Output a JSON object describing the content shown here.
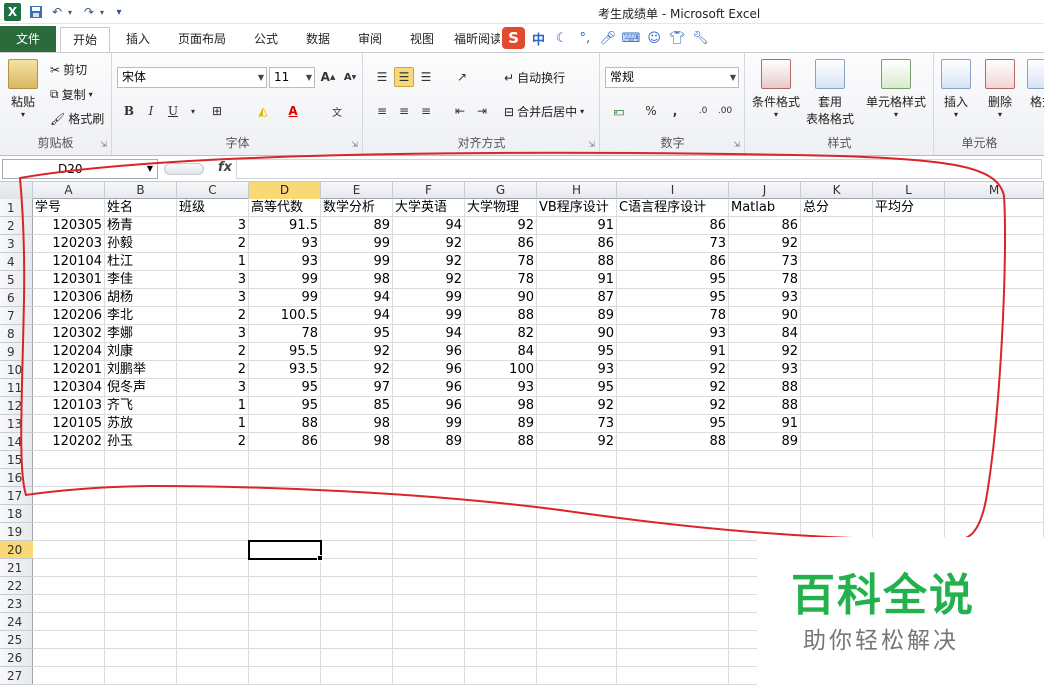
{
  "window": {
    "title": "考生成绩单 - Microsoft Excel",
    "app_icon": "X"
  },
  "quick_access": {
    "save": "save-icon",
    "undo": "undo-icon",
    "redo": "redo-icon",
    "customize": "customize-icon"
  },
  "tabs": [
    "文件",
    "开始",
    "插入",
    "页面布局",
    "公式",
    "数据",
    "审阅",
    "视图",
    "福昕阅读"
  ],
  "ime": {
    "logo": "S",
    "mode": "中"
  },
  "ribbon": {
    "clipboard": {
      "label": "剪贴板",
      "paste": "粘贴",
      "cut": "剪切",
      "copy": "复制",
      "format_painter": "格式刷"
    },
    "font": {
      "label": "字体",
      "family": "宋体",
      "size": "11"
    },
    "alignment": {
      "label": "对齐方式",
      "wrap": "自动换行",
      "merge": "合并后居中"
    },
    "number": {
      "label": "数字",
      "format": "常规"
    },
    "styles": {
      "label": "样式",
      "conditional": "条件格式",
      "table_line1": "套用",
      "table_line2": "表格格式",
      "cell_styles": "单元格样式"
    },
    "cells": {
      "label": "单元格",
      "insert": "插入",
      "delete": "删除",
      "format": "格式"
    }
  },
  "formula_bar": {
    "name_box": "D20",
    "fx": "fx",
    "content": ""
  },
  "columns": [
    "A",
    "B",
    "C",
    "D",
    "E",
    "F",
    "G",
    "H",
    "I",
    "J",
    "K",
    "L",
    "M"
  ],
  "rows": [
    "1",
    "2",
    "3",
    "4",
    "5",
    "6",
    "7",
    "8",
    "9",
    "10",
    "11",
    "12",
    "13",
    "14",
    "15",
    "16",
    "17",
    "18",
    "19",
    "20",
    "21",
    "22",
    "23",
    "24",
    "25",
    "26",
    "27"
  ],
  "selected": {
    "column": "D",
    "row": "20"
  },
  "sheet": {
    "headers": [
      "学号",
      "姓名",
      "班级",
      "高等代数",
      "数学分析",
      "大学英语",
      "大学物理",
      "VB程序设计",
      "C语言程序设计",
      "Matlab",
      "总分",
      "平均分"
    ],
    "rows": [
      [
        "120305",
        "杨青",
        "3",
        "91.5",
        "89",
        "94",
        "92",
        "91",
        "86",
        "86"
      ],
      [
        "120203",
        "孙毅",
        "2",
        "93",
        "99",
        "92",
        "86",
        "86",
        "73",
        "92"
      ],
      [
        "120104",
        "杜江",
        "1",
        "93",
        "99",
        "92",
        "78",
        "88",
        "86",
        "73"
      ],
      [
        "120301",
        "李佳",
        "3",
        "99",
        "98",
        "92",
        "78",
        "91",
        "95",
        "78"
      ],
      [
        "120306",
        "胡杨",
        "3",
        "99",
        "94",
        "99",
        "90",
        "87",
        "95",
        "93"
      ],
      [
        "120206",
        "李北",
        "2",
        "100.5",
        "94",
        "99",
        "88",
        "89",
        "78",
        "90"
      ],
      [
        "120302",
        "李娜",
        "3",
        "78",
        "95",
        "94",
        "82",
        "90",
        "93",
        "84"
      ],
      [
        "120204",
        "刘康",
        "2",
        "95.5",
        "92",
        "96",
        "84",
        "95",
        "91",
        "92"
      ],
      [
        "120201",
        "刘鹏举",
        "2",
        "93.5",
        "92",
        "96",
        "100",
        "93",
        "92",
        "93"
      ],
      [
        "120304",
        "倪冬声",
        "3",
        "95",
        "97",
        "96",
        "93",
        "95",
        "92",
        "88"
      ],
      [
        "120103",
        "齐飞",
        "1",
        "95",
        "85",
        "96",
        "98",
        "92",
        "92",
        "88"
      ],
      [
        "120105",
        "苏放",
        "1",
        "88",
        "98",
        "99",
        "89",
        "73",
        "95",
        "91"
      ],
      [
        "120202",
        "孙玉",
        "2",
        "86",
        "98",
        "89",
        "88",
        "92",
        "88",
        "89"
      ]
    ]
  },
  "watermark": {
    "title": "百科全说",
    "subtitle": "助你轻松解决"
  },
  "annotation_color": "#d9252a",
  "accent_color": "#2b6a3a"
}
